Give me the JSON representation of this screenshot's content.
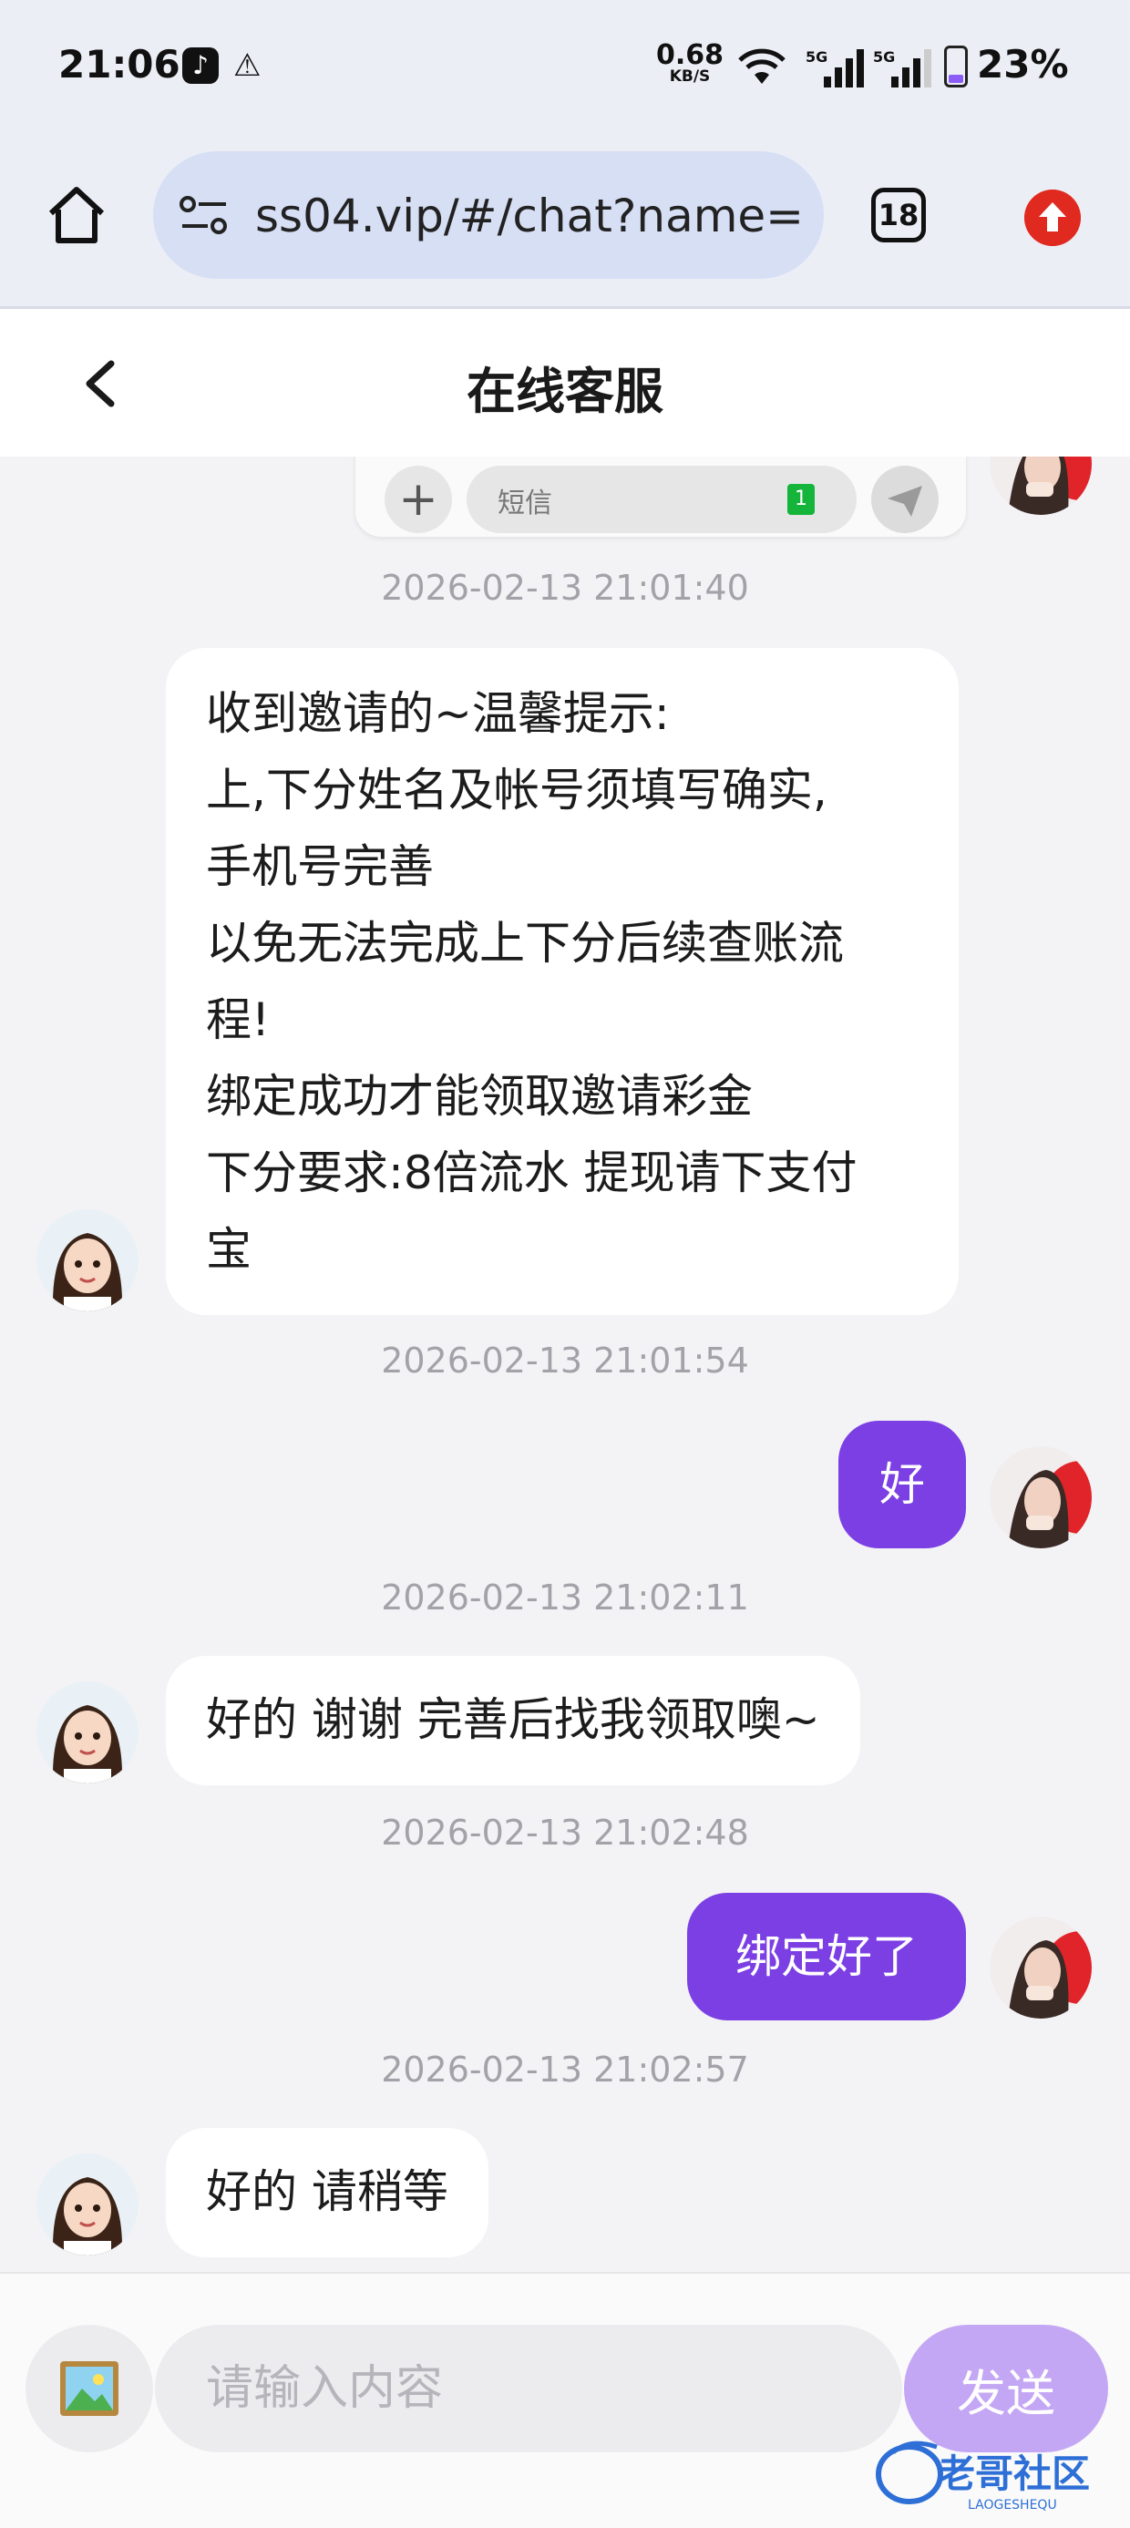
{
  "status_bar": {
    "time": "21:06",
    "net_speed_value": "0.68",
    "net_speed_unit": "KB/S",
    "sig1_label": "5G",
    "sig2_label": "5G",
    "battery": "23%"
  },
  "browser": {
    "url": "ss04.vip/#/chat?name=",
    "tab_count": "18"
  },
  "chat": {
    "title": "在线客服",
    "preview": {
      "input_placeholder": "短信",
      "badge": "1"
    },
    "messages": [
      {
        "time": "2026-02-13 21:01:40",
        "from": "agent",
        "lines": [
          "收到邀请的~温馨提示:",
          "上,下分姓名及帐号须填写确实,",
          "手机号完善",
          "以免无法完成上下分后续查账流",
          "程!",
          "绑定成功才能领取邀请彩金",
          "下分要求:8倍流水 提现请下支付",
          "宝"
        ]
      },
      {
        "time": "2026-02-13 21:01:54",
        "from": "user",
        "lines": [
          "好"
        ]
      },
      {
        "time": "2026-02-13 21:02:11",
        "from": "agent",
        "lines": [
          "好的 谢谢 完善后找我领取噢~"
        ]
      },
      {
        "time": "2026-02-13 21:02:48",
        "from": "user",
        "lines": [
          "绑定好了"
        ]
      },
      {
        "time": "2026-02-13 21:02:57",
        "from": "agent",
        "lines": [
          "好的 请稍等"
        ]
      }
    ]
  },
  "input": {
    "placeholder": "请输入内容",
    "send_label": "发送"
  },
  "colors": {
    "accent": "#7b3fe4",
    "send_disabled": "#c4a7f4"
  },
  "watermark": {
    "text": "老哥社区",
    "subtext": "LAOGESHEQU"
  }
}
